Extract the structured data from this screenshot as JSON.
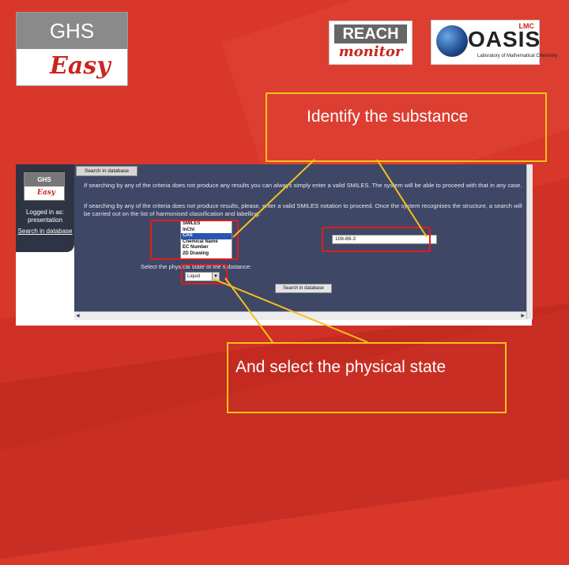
{
  "logos": {
    "ghs": {
      "top": "GHS",
      "bottom": "Easy"
    },
    "reach": {
      "top": "REACH",
      "bottom": "monitor"
    },
    "oasis": {
      "word": "OASIS",
      "tag": "LMC",
      "subtitle": "Laboratory of Mathematical Chemistry"
    }
  },
  "callouts": {
    "identify": "Identify the substance",
    "physical_state": "And select the physical state"
  },
  "app": {
    "sidebar": {
      "logo_top": "GHS",
      "logo_bottom": "Easy",
      "logged_in": "Logged in as: presentation",
      "search_link": "Search in database"
    },
    "tab_label": "Search in database",
    "info_1": "If searching by any of the criteria does not produce any results you can always simply enter a valid SMILES. The system will be able to proceed with that in any case.",
    "info_2": "If searching by any of the criteria does not produce results, please, enter a valid SMILES notation to proceed. Once the system recognises the structure, a search will be carried out on the list of harmonised classification and labelling.",
    "criteria_options": [
      "SMILES",
      "InChI",
      "CAS",
      "Chemical Name",
      "EC Number",
      "2D Drawing"
    ],
    "criteria_selected": "CAS",
    "identifier_value": "108-88-3",
    "state_label": "Select the physical state of the substance:",
    "state_value": "Liquid",
    "search_button": "Search in database"
  },
  "colors": {
    "background": "#d8372a",
    "callout_border": "#f3c11b",
    "highlight": "#e11c1c",
    "app_panel": "#3f4766"
  }
}
